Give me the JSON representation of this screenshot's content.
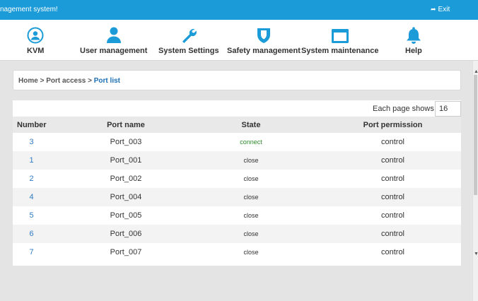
{
  "topbar": {
    "title": "nagement system!",
    "exit_label": "Exit",
    "bg_color": "#1b9bd8"
  },
  "nav": {
    "accent_color": "#1b9bd8",
    "items": [
      {
        "label": "KVM",
        "icon": "kvm-icon"
      },
      {
        "label": "User management",
        "icon": "user-icon"
      },
      {
        "label": "System Settings",
        "icon": "wrench-icon"
      },
      {
        "label": "Safety management",
        "icon": "shield-icon"
      },
      {
        "label": "System maintenance",
        "icon": "monitor-icon"
      },
      {
        "label": "Help",
        "icon": "bell-icon"
      }
    ]
  },
  "breadcrumb": {
    "home": "Home",
    "sep1": " > ",
    "section": "Port access",
    "sep2": " > ",
    "current": "Port list"
  },
  "pager": {
    "label": "Each page shows :",
    "value": "16"
  },
  "table": {
    "headers": {
      "number": "Number",
      "name": "Port name",
      "state": "State",
      "permission": "Port permission"
    },
    "rows": [
      {
        "number": "3",
        "name": "Port_003",
        "state": "connect",
        "permission": "control"
      },
      {
        "number": "1",
        "name": "Port_001",
        "state": "close",
        "permission": "control"
      },
      {
        "number": "2",
        "name": "Port_002",
        "state": "close",
        "permission": "control"
      },
      {
        "number": "4",
        "name": "Port_004",
        "state": "close",
        "permission": "control"
      },
      {
        "number": "5",
        "name": "Port_005",
        "state": "close",
        "permission": "control"
      },
      {
        "number": "6",
        "name": "Port_006",
        "state": "close",
        "permission": "control"
      },
      {
        "number": "7",
        "name": "Port_007",
        "state": "close",
        "permission": "control"
      }
    ]
  }
}
